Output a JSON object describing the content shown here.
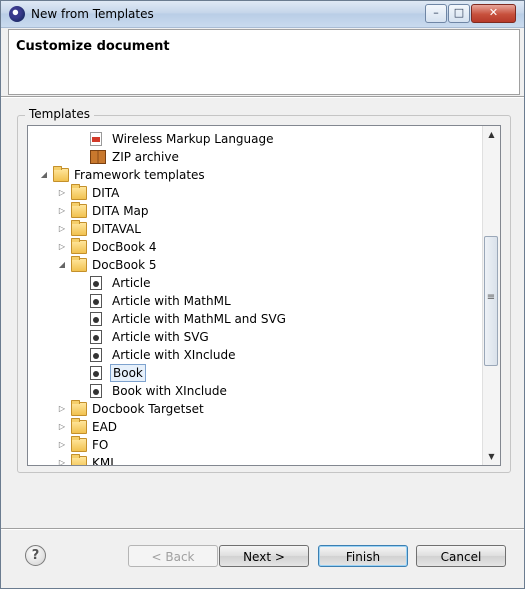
{
  "window": {
    "title": "New from Templates",
    "controls": {
      "minimize": "–",
      "maximize": "□",
      "close": "✕"
    }
  },
  "header": {
    "title": "Customize document"
  },
  "templates": {
    "group_label": "Templates",
    "items": [
      {
        "label": "Wireless Markup Language",
        "indent": 2,
        "icon": "wml-file-icon",
        "toggle": ""
      },
      {
        "label": "ZIP archive",
        "indent": 2,
        "icon": "zip-archive-icon",
        "toggle": ""
      },
      {
        "label": "Framework templates",
        "indent": 0,
        "icon": "folder-icon",
        "toggle": "expanded"
      },
      {
        "label": "DITA",
        "indent": 1,
        "icon": "folder-icon",
        "toggle": "collapsed"
      },
      {
        "label": "DITA Map",
        "indent": 1,
        "icon": "folder-icon",
        "toggle": "collapsed"
      },
      {
        "label": "DITAVAL",
        "indent": 1,
        "icon": "folder-icon",
        "toggle": "collapsed"
      },
      {
        "label": "DocBook 4",
        "indent": 1,
        "icon": "folder-icon",
        "toggle": "collapsed"
      },
      {
        "label": "DocBook 5",
        "indent": 1,
        "icon": "folder-icon",
        "toggle": "expanded"
      },
      {
        "label": "Article",
        "indent": 2,
        "icon": "docbook-template-icon",
        "toggle": ""
      },
      {
        "label": "Article with MathML",
        "indent": 2,
        "icon": "docbook-template-icon",
        "toggle": ""
      },
      {
        "label": "Article with MathML and SVG",
        "indent": 2,
        "icon": "docbook-template-icon",
        "toggle": ""
      },
      {
        "label": "Article with SVG",
        "indent": 2,
        "icon": "docbook-template-icon",
        "toggle": ""
      },
      {
        "label": "Article with XInclude",
        "indent": 2,
        "icon": "docbook-template-icon",
        "toggle": ""
      },
      {
        "label": "Book",
        "indent": 2,
        "icon": "docbook-template-icon",
        "toggle": "",
        "selected": true
      },
      {
        "label": "Book with XInclude",
        "indent": 2,
        "icon": "docbook-template-icon",
        "toggle": ""
      },
      {
        "label": "Docbook Targetset",
        "indent": 1,
        "icon": "folder-icon",
        "toggle": "collapsed"
      },
      {
        "label": "EAD",
        "indent": 1,
        "icon": "folder-icon",
        "toggle": "collapsed"
      },
      {
        "label": "FO",
        "indent": 1,
        "icon": "folder-icon",
        "toggle": "collapsed"
      },
      {
        "label": "KML",
        "indent": 1,
        "icon": "folder-icon",
        "toggle": "collapsed"
      }
    ]
  },
  "buttons": {
    "help": "?",
    "back": "< Back",
    "next": "Next >",
    "finish": "Finish",
    "cancel": "Cancel"
  }
}
